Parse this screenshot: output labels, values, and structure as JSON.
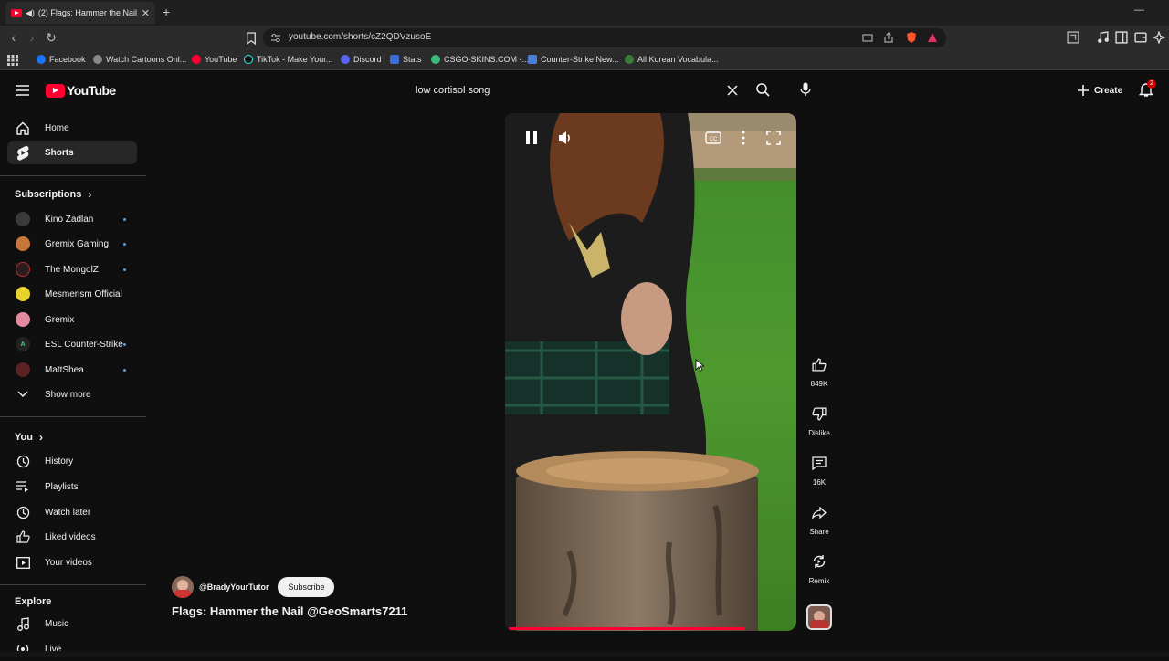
{
  "browser": {
    "tab_title": "(2) Flags: Hammer the Nail @",
    "url": "youtube.com/shorts/cZ2QDVzusoE",
    "bookmarks": [
      "Facebook",
      "Watch Cartoons Onl...",
      "YouTube",
      "TikTok - Make Your...",
      "Discord",
      "Stats",
      "CSGO-SKINS.COM -...",
      "Counter-Strike New...",
      "All Korean Vocabula..."
    ]
  },
  "masthead": {
    "logo_text": "YouTube",
    "search_value": "low cortisol song",
    "create_label": "Create",
    "notification_count": "2"
  },
  "sidebar": {
    "home": "Home",
    "shorts": "Shorts",
    "subscriptions_heading": "Subscriptions",
    "subscriptions": [
      "Kino Zadlan",
      "Gremix Gaming",
      "The MongolZ",
      "Mesmerism Official",
      "Gremix",
      "ESL Counter-Strike",
      "MattShea"
    ],
    "show_more": "Show more",
    "you_heading": "You",
    "you_items": [
      "History",
      "Playlists",
      "Watch later",
      "Liked videos",
      "Your videos"
    ],
    "explore_heading": "Explore",
    "explore_items": [
      "Music",
      "Live"
    ]
  },
  "short": {
    "channel": "@BradyYourTutor",
    "subscribe_label": "Subscribe",
    "title": "Flags: Hammer the Nail @GeoSmarts7211",
    "progress": 0.83,
    "actions": {
      "likes": "849K",
      "dislike": "Dislike",
      "comments": "16K",
      "share": "Share",
      "remix": "Remix"
    }
  },
  "colors": {
    "brand_red": "#ff0033",
    "background": "#0f0f0f",
    "active_item": "#272727",
    "new_dot": "#3ea6ff"
  }
}
